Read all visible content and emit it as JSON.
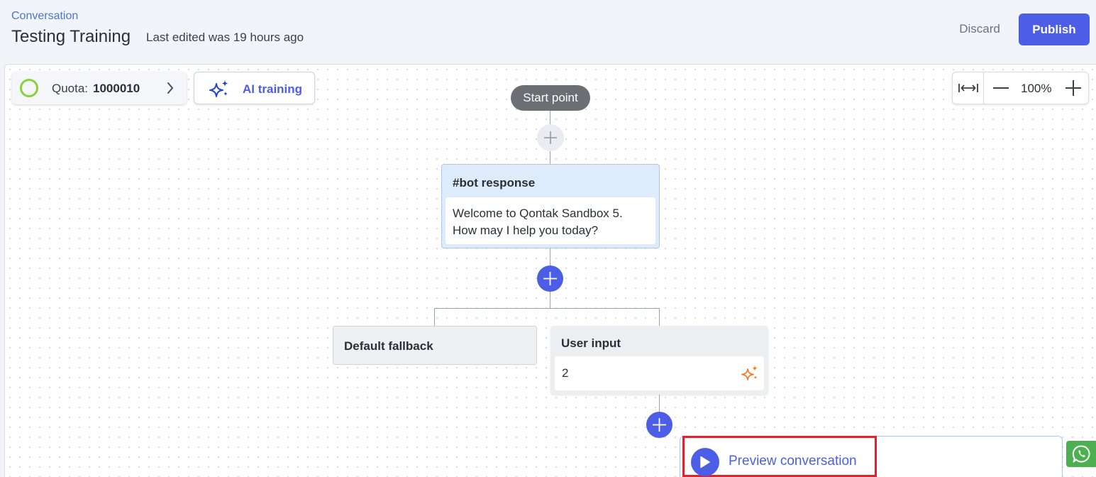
{
  "header": {
    "breadcrumb": "Conversation",
    "title": "Testing Training",
    "last_edited": "Last edited was 19 hours ago",
    "discard_label": "Discard",
    "publish_label": "Publish"
  },
  "toolbar": {
    "quota_label": "Quota:",
    "quota_value": "1000010",
    "ai_training_label": "AI training",
    "zoom_level": "100%"
  },
  "flow": {
    "start_label": "Start point",
    "bot_response": {
      "title": "#bot response",
      "message": "Welcome to Qontak Sandbox 5. How may I help you today?"
    },
    "fallback_title": "Default fallback",
    "user_input": {
      "title": "User input",
      "value": "2"
    }
  },
  "preview": {
    "label": "Preview conversation"
  },
  "colors": {
    "primary": "#4d5ee6",
    "quota_ring": "#8ad13a",
    "sparkle_orange": "#f07d2a",
    "highlight_border": "#e3202b",
    "whatsapp": "#4caf50"
  },
  "icons": [
    "chevron-right-icon",
    "sparkle-icon",
    "fit-width-icon",
    "minus-icon",
    "plus-icon",
    "play-icon",
    "whatsapp-icon"
  ]
}
